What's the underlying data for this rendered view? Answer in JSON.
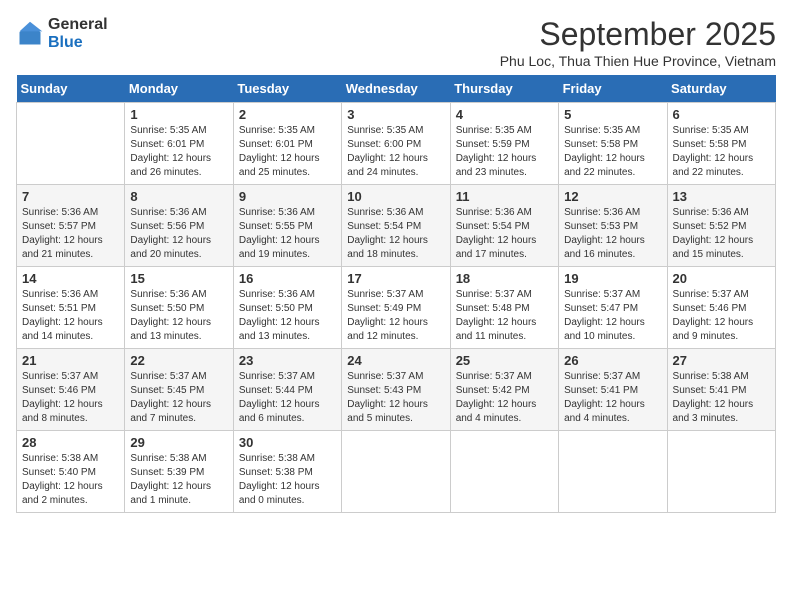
{
  "header": {
    "logo_general": "General",
    "logo_blue": "Blue",
    "month_year": "September 2025",
    "location": "Phu Loc, Thua Thien Hue Province, Vietnam"
  },
  "days_of_week": [
    "Sunday",
    "Monday",
    "Tuesday",
    "Wednesday",
    "Thursday",
    "Friday",
    "Saturday"
  ],
  "weeks": [
    [
      {
        "day": "",
        "sunrise": "",
        "sunset": "",
        "daylight": ""
      },
      {
        "day": "1",
        "sunrise": "Sunrise: 5:35 AM",
        "sunset": "Sunset: 6:01 PM",
        "daylight": "Daylight: 12 hours and 26 minutes."
      },
      {
        "day": "2",
        "sunrise": "Sunrise: 5:35 AM",
        "sunset": "Sunset: 6:01 PM",
        "daylight": "Daylight: 12 hours and 25 minutes."
      },
      {
        "day": "3",
        "sunrise": "Sunrise: 5:35 AM",
        "sunset": "Sunset: 6:00 PM",
        "daylight": "Daylight: 12 hours and 24 minutes."
      },
      {
        "day": "4",
        "sunrise": "Sunrise: 5:35 AM",
        "sunset": "Sunset: 5:59 PM",
        "daylight": "Daylight: 12 hours and 23 minutes."
      },
      {
        "day": "5",
        "sunrise": "Sunrise: 5:35 AM",
        "sunset": "Sunset: 5:58 PM",
        "daylight": "Daylight: 12 hours and 22 minutes."
      },
      {
        "day": "6",
        "sunrise": "Sunrise: 5:35 AM",
        "sunset": "Sunset: 5:58 PM",
        "daylight": "Daylight: 12 hours and 22 minutes."
      }
    ],
    [
      {
        "day": "7",
        "sunrise": "Sunrise: 5:36 AM",
        "sunset": "Sunset: 5:57 PM",
        "daylight": "Daylight: 12 hours and 21 minutes."
      },
      {
        "day": "8",
        "sunrise": "Sunrise: 5:36 AM",
        "sunset": "Sunset: 5:56 PM",
        "daylight": "Daylight: 12 hours and 20 minutes."
      },
      {
        "day": "9",
        "sunrise": "Sunrise: 5:36 AM",
        "sunset": "Sunset: 5:55 PM",
        "daylight": "Daylight: 12 hours and 19 minutes."
      },
      {
        "day": "10",
        "sunrise": "Sunrise: 5:36 AM",
        "sunset": "Sunset: 5:54 PM",
        "daylight": "Daylight: 12 hours and 18 minutes."
      },
      {
        "day": "11",
        "sunrise": "Sunrise: 5:36 AM",
        "sunset": "Sunset: 5:54 PM",
        "daylight": "Daylight: 12 hours and 17 minutes."
      },
      {
        "day": "12",
        "sunrise": "Sunrise: 5:36 AM",
        "sunset": "Sunset: 5:53 PM",
        "daylight": "Daylight: 12 hours and 16 minutes."
      },
      {
        "day": "13",
        "sunrise": "Sunrise: 5:36 AM",
        "sunset": "Sunset: 5:52 PM",
        "daylight": "Daylight: 12 hours and 15 minutes."
      }
    ],
    [
      {
        "day": "14",
        "sunrise": "Sunrise: 5:36 AM",
        "sunset": "Sunset: 5:51 PM",
        "daylight": "Daylight: 12 hours and 14 minutes."
      },
      {
        "day": "15",
        "sunrise": "Sunrise: 5:36 AM",
        "sunset": "Sunset: 5:50 PM",
        "daylight": "Daylight: 12 hours and 13 minutes."
      },
      {
        "day": "16",
        "sunrise": "Sunrise: 5:36 AM",
        "sunset": "Sunset: 5:50 PM",
        "daylight": "Daylight: 12 hours and 13 minutes."
      },
      {
        "day": "17",
        "sunrise": "Sunrise: 5:37 AM",
        "sunset": "Sunset: 5:49 PM",
        "daylight": "Daylight: 12 hours and 12 minutes."
      },
      {
        "day": "18",
        "sunrise": "Sunrise: 5:37 AM",
        "sunset": "Sunset: 5:48 PM",
        "daylight": "Daylight: 12 hours and 11 minutes."
      },
      {
        "day": "19",
        "sunrise": "Sunrise: 5:37 AM",
        "sunset": "Sunset: 5:47 PM",
        "daylight": "Daylight: 12 hours and 10 minutes."
      },
      {
        "day": "20",
        "sunrise": "Sunrise: 5:37 AM",
        "sunset": "Sunset: 5:46 PM",
        "daylight": "Daylight: 12 hours and 9 minutes."
      }
    ],
    [
      {
        "day": "21",
        "sunrise": "Sunrise: 5:37 AM",
        "sunset": "Sunset: 5:46 PM",
        "daylight": "Daylight: 12 hours and 8 minutes."
      },
      {
        "day": "22",
        "sunrise": "Sunrise: 5:37 AM",
        "sunset": "Sunset: 5:45 PM",
        "daylight": "Daylight: 12 hours and 7 minutes."
      },
      {
        "day": "23",
        "sunrise": "Sunrise: 5:37 AM",
        "sunset": "Sunset: 5:44 PM",
        "daylight": "Daylight: 12 hours and 6 minutes."
      },
      {
        "day": "24",
        "sunrise": "Sunrise: 5:37 AM",
        "sunset": "Sunset: 5:43 PM",
        "daylight": "Daylight: 12 hours and 5 minutes."
      },
      {
        "day": "25",
        "sunrise": "Sunrise: 5:37 AM",
        "sunset": "Sunset: 5:42 PM",
        "daylight": "Daylight: 12 hours and 4 minutes."
      },
      {
        "day": "26",
        "sunrise": "Sunrise: 5:37 AM",
        "sunset": "Sunset: 5:41 PM",
        "daylight": "Daylight: 12 hours and 4 minutes."
      },
      {
        "day": "27",
        "sunrise": "Sunrise: 5:38 AM",
        "sunset": "Sunset: 5:41 PM",
        "daylight": "Daylight: 12 hours and 3 minutes."
      }
    ],
    [
      {
        "day": "28",
        "sunrise": "Sunrise: 5:38 AM",
        "sunset": "Sunset: 5:40 PM",
        "daylight": "Daylight: 12 hours and 2 minutes."
      },
      {
        "day": "29",
        "sunrise": "Sunrise: 5:38 AM",
        "sunset": "Sunset: 5:39 PM",
        "daylight": "Daylight: 12 hours and 1 minute."
      },
      {
        "day": "30",
        "sunrise": "Sunrise: 5:38 AM",
        "sunset": "Sunset: 5:38 PM",
        "daylight": "Daylight: 12 hours and 0 minutes."
      },
      {
        "day": "",
        "sunrise": "",
        "sunset": "",
        "daylight": ""
      },
      {
        "day": "",
        "sunrise": "",
        "sunset": "",
        "daylight": ""
      },
      {
        "day": "",
        "sunrise": "",
        "sunset": "",
        "daylight": ""
      },
      {
        "day": "",
        "sunrise": "",
        "sunset": "",
        "daylight": ""
      }
    ]
  ]
}
